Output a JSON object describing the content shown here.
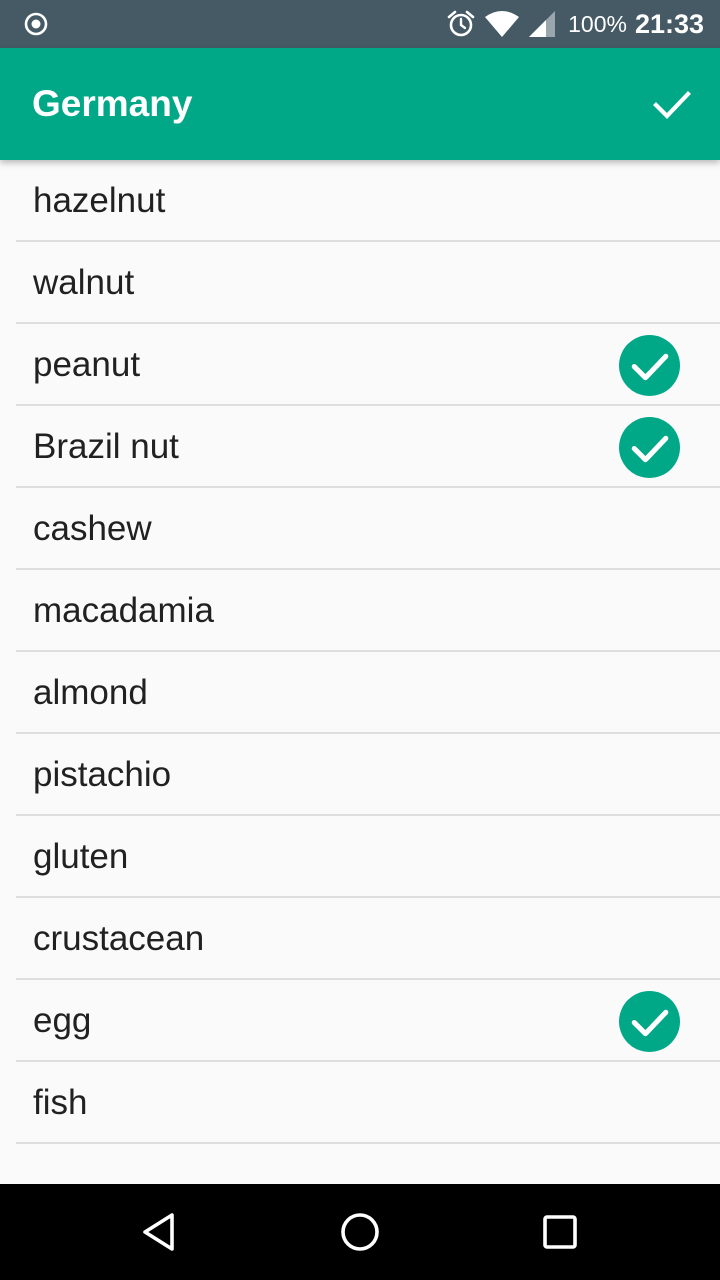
{
  "status_bar": {
    "battery": "100%",
    "time": "21:33"
  },
  "app_bar": {
    "title": "Germany"
  },
  "allergens": [
    {
      "label": "hazelnut",
      "checked": false
    },
    {
      "label": "walnut",
      "checked": false
    },
    {
      "label": "peanut",
      "checked": true
    },
    {
      "label": "Brazil nut",
      "checked": true
    },
    {
      "label": "cashew",
      "checked": false
    },
    {
      "label": "macadamia",
      "checked": false
    },
    {
      "label": "almond",
      "checked": false
    },
    {
      "label": "pistachio",
      "checked": false
    },
    {
      "label": "gluten",
      "checked": false
    },
    {
      "label": "crustacean",
      "checked": false
    },
    {
      "label": "egg",
      "checked": true
    },
    {
      "label": "fish",
      "checked": false
    }
  ],
  "colors": {
    "status_bar": "#455a64",
    "app_bar": "#00a887",
    "check_fill": "#00a887",
    "background": "#fafafa",
    "divider": "#dedede",
    "text": "#212121",
    "nav_bar": "#000000"
  },
  "icons": {
    "status_left": "record-icon",
    "alarm": "alarm-icon",
    "wifi": "wifi-icon",
    "signal": "signal-icon",
    "confirm": "check-icon",
    "item_checked": "check-circle-icon",
    "nav_back": "back-triangle-icon",
    "nav_home": "home-circle-icon",
    "nav_recents": "recents-square-icon"
  }
}
